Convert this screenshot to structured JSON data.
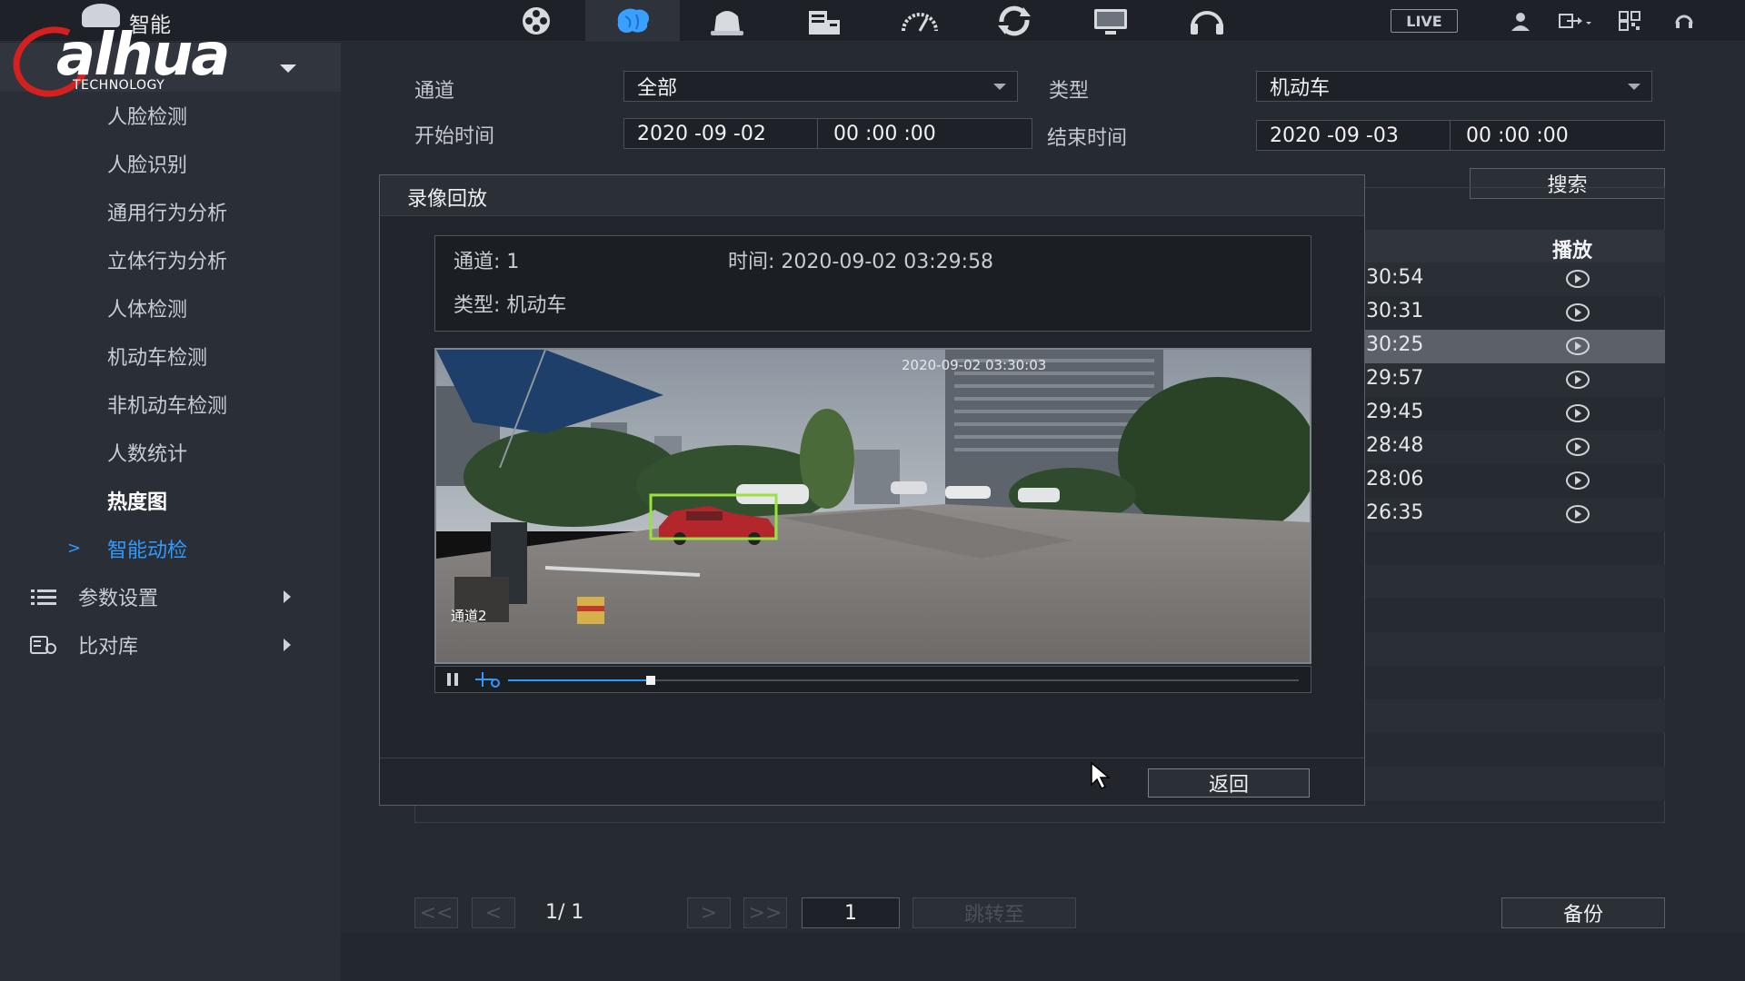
{
  "topbar": {
    "title": "智能",
    "brand": {
      "logo_text": "alhua",
      "logo_sub": "TECHNOLOGY"
    },
    "nav_icons": [
      "film-reel-icon",
      "brain-icon",
      "alarm-bell-icon",
      "storage-icon",
      "gauge-icon",
      "refresh-icon",
      "monitor-icon",
      "headset-icon"
    ],
    "active_nav": "brain-icon",
    "live_label": "LIVE",
    "right_icons": [
      "user-icon",
      "logout-icon",
      "qr-icon",
      "help-icon"
    ]
  },
  "sidebar": {
    "items": [
      {
        "label": "人脸检测"
      },
      {
        "label": "人脸识别"
      },
      {
        "label": "通用行为分析"
      },
      {
        "label": "立体行为分析"
      },
      {
        "label": "人体检测"
      },
      {
        "label": "机动车检测"
      },
      {
        "label": "非机动车检测"
      },
      {
        "label": "人数统计"
      },
      {
        "label": "热度图"
      },
      {
        "label": "智能动检",
        "arrow": ">"
      }
    ],
    "groups": [
      {
        "label": "参数设置"
      },
      {
        "label": "比对库"
      }
    ]
  },
  "search": {
    "channel_label": "通道",
    "channel_value": "全部",
    "type_label": "类型",
    "type_value": "机动车",
    "start_label": "开始时间",
    "start_date": "2020 -09 -02",
    "start_time": "00 :00 :00",
    "end_label": "结束时间",
    "end_date": "2020 -09 -03",
    "end_time": "00 :00 :00",
    "search_button": "搜索"
  },
  "results": {
    "play_header": "播放",
    "rows": [
      "30:54",
      "30:31",
      "30:25",
      "29:57",
      "29:45",
      "28:48",
      "28:06",
      "26:35"
    ],
    "selected_index": 2
  },
  "pagination": {
    "first": "<<",
    "prev": "<",
    "page_info": "1/  1",
    "next": ">",
    "last": ">>",
    "page_input": "1",
    "goto_button": "跳转至",
    "backup_button": "备份"
  },
  "dialog": {
    "title": "录像回放",
    "channel": "通道: 1",
    "time": "时间: 2020-09-02 03:29:58",
    "type": "类型: 机动车",
    "video_timestamp": "2020-09-02 03:30:03",
    "video_channel": "通道2",
    "progress": 0.18,
    "back_button": "返回"
  },
  "colors": {
    "accent": "#2f9bff",
    "detection_box": "#9be23a",
    "logo_red": "#d5201f"
  }
}
